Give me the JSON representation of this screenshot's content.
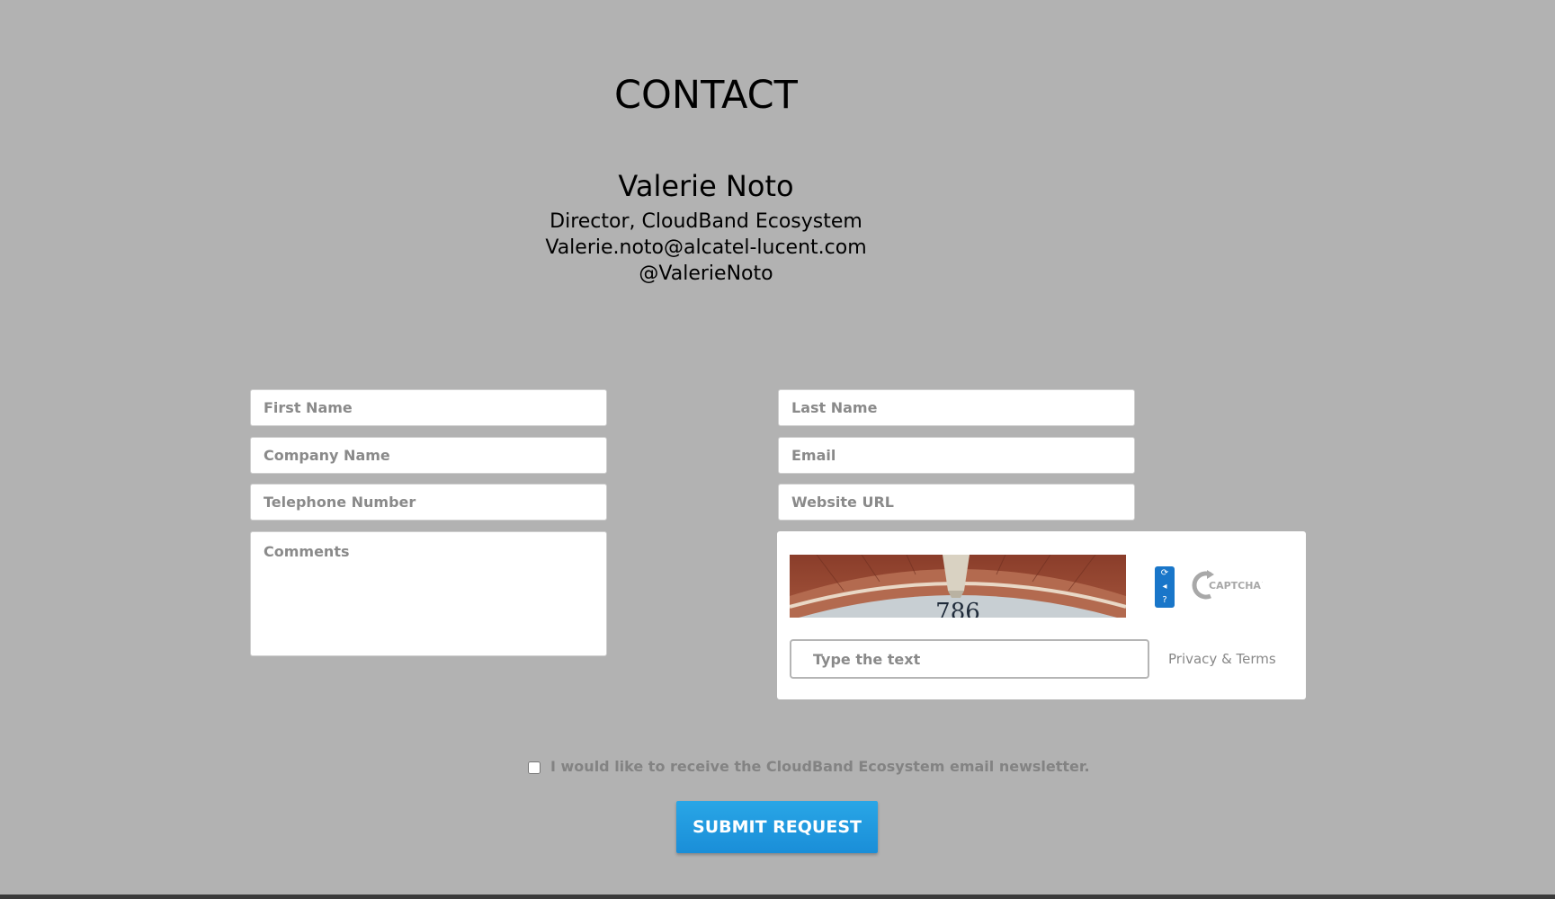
{
  "colors": {
    "page_background": "#b2b2b2",
    "submit_button": "#1f99df",
    "captcha_accent": "#1976c9",
    "footer_bar": "#3a3a3a"
  },
  "header": {
    "title": "CONTACT"
  },
  "contact": {
    "name": "Valerie Noto",
    "role": "Director, CloudBand Ecosystem",
    "email": "Valerie.noto@alcatel-lucent.com",
    "twitter": "@ValerieNoto"
  },
  "form": {
    "first_name_placeholder": "First Name",
    "last_name_placeholder": "Last Name",
    "company_placeholder": "Company Name",
    "email_placeholder": "Email",
    "telephone_placeholder": "Telephone Number",
    "website_placeholder": "Website URL",
    "comments_placeholder": "Comments"
  },
  "captcha": {
    "image_text": "786",
    "input_placeholder": "Type the text",
    "privacy_link": "Privacy & Terms",
    "logo_text": "CAPTCHA™",
    "icons": [
      "refresh-icon",
      "audio-icon",
      "help-icon"
    ]
  },
  "newsletter": {
    "label": "I would like to receive the CloudBand Ecosystem email newsletter.",
    "checked": false
  },
  "submit": {
    "label": "SUBMIT REQUEST"
  }
}
